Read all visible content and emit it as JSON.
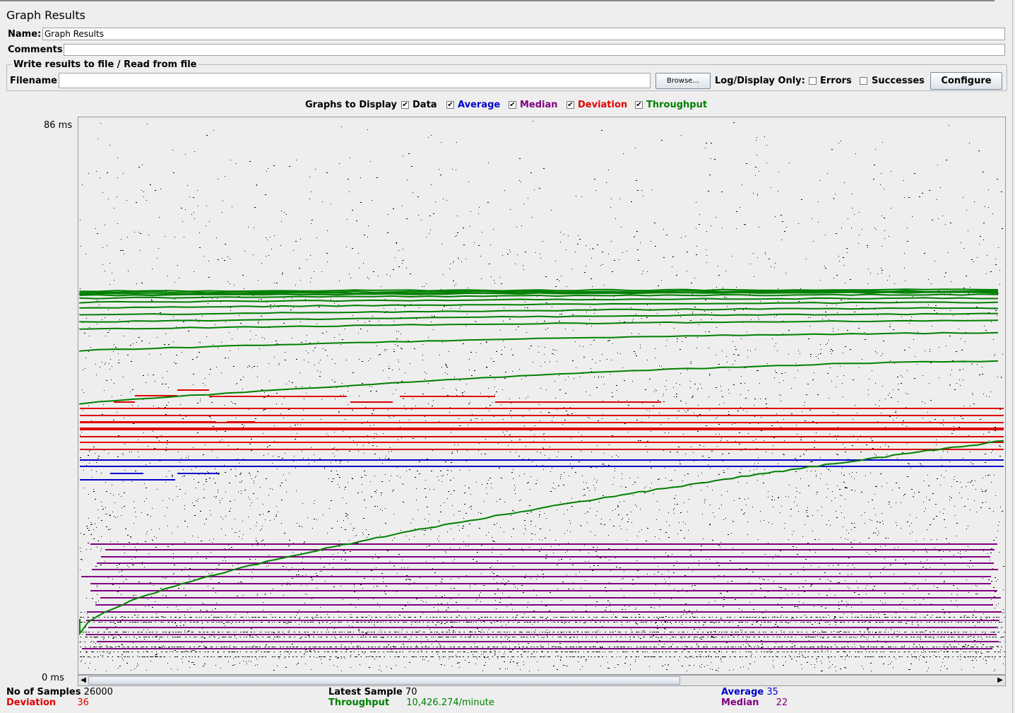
{
  "window": {
    "title": "Graph Results"
  },
  "form": {
    "name_label": "Name:",
    "name_value": "Graph Results",
    "comments_label": "Comments:",
    "comments_value": "",
    "file_section_title": "Write results to file / Read from file",
    "filename_label": "Filename",
    "filename_value": "",
    "browse_label": "Browse...",
    "log_display_label": "Log/Display Only:",
    "errors_label": "Errors",
    "errors_checked": false,
    "successes_label": "Successes",
    "successes_checked": false,
    "configure_label": "Configure"
  },
  "graphs_to_display": {
    "label": "Graphs to Display",
    "options": [
      {
        "label": "Data",
        "checked": true,
        "color": "#000000"
      },
      {
        "label": "Average",
        "checked": true,
        "color": "#0000cc"
      },
      {
        "label": "Median",
        "checked": true,
        "color": "#800080"
      },
      {
        "label": "Deviation",
        "checked": true,
        "color": "#e00000"
      },
      {
        "label": "Throughput",
        "checked": true,
        "color": "#008000"
      }
    ]
  },
  "chart_data": {
    "type": "scatter",
    "y_max_label": "86 ms",
    "y_min_label": "0 ms",
    "ylim": [
      0,
      86
    ],
    "series": [
      {
        "name": "Data",
        "color": "#000000"
      },
      {
        "name": "Average",
        "color": "#0000cc"
      },
      {
        "name": "Median",
        "color": "#800080"
      },
      {
        "name": "Deviation",
        "color": "#e00000"
      },
      {
        "name": "Throughput",
        "color": "#008000"
      }
    ]
  },
  "stats": {
    "samples_label": "No of Samples",
    "samples_value": "26000",
    "deviation_label": "Deviation",
    "deviation_value": "36",
    "latest_label": "Latest Sample",
    "latest_value": "70",
    "throughput_label": "Throughput",
    "throughput_value": "10,426.274/minute",
    "average_label": "Average",
    "average_value": "35",
    "median_label": "Median",
    "median_value": "22"
  },
  "colors": {
    "data": "#000000",
    "average": "#0000cc",
    "median": "#800080",
    "deviation": "#e00000",
    "throughput": "#008000"
  }
}
